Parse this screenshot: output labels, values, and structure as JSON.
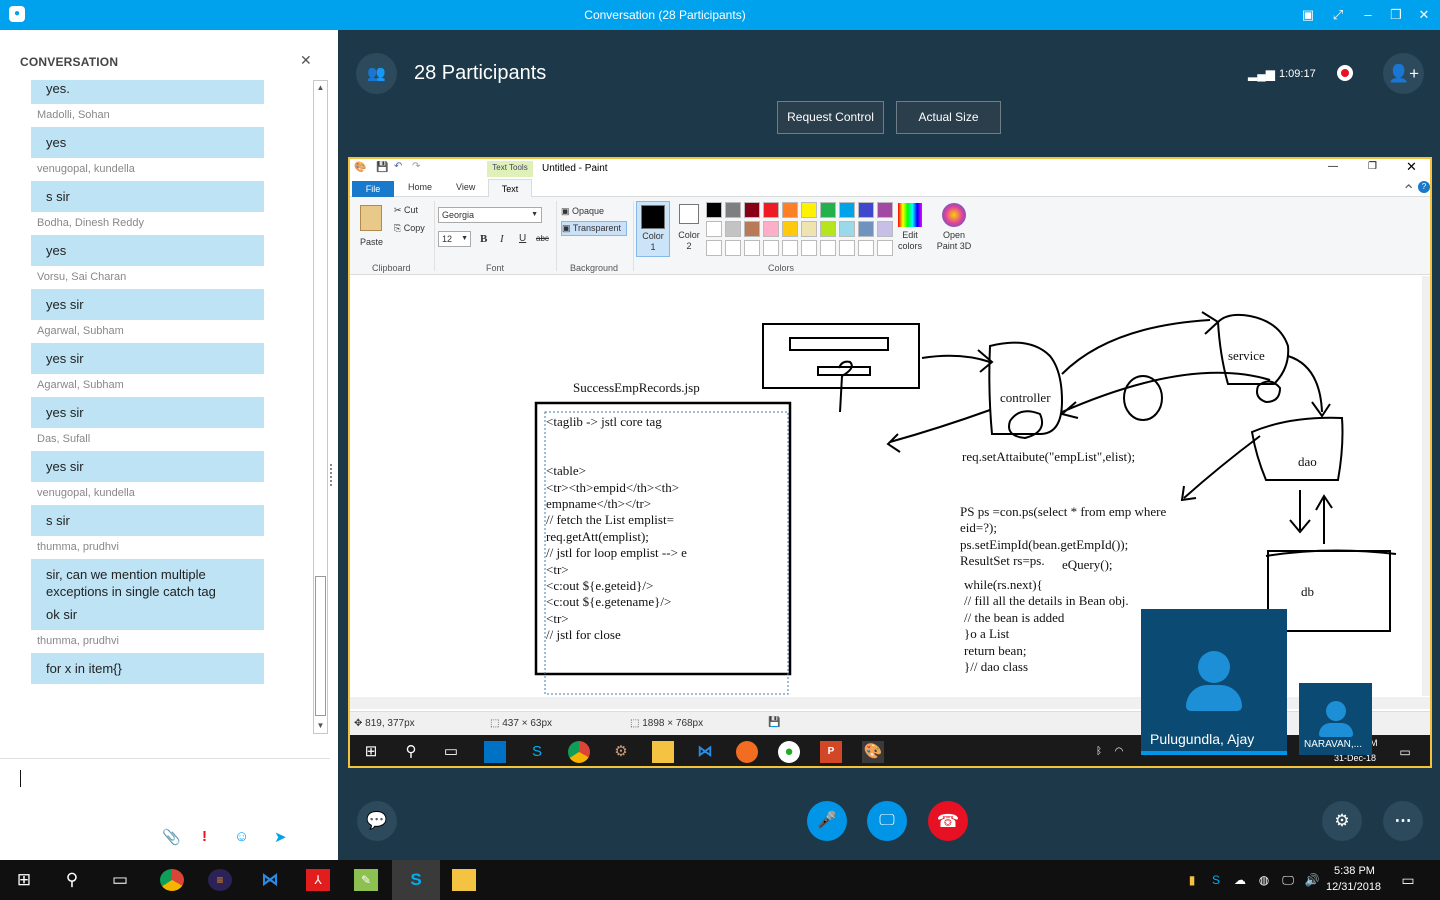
{
  "window": {
    "title": "Conversation (28 Participants)"
  },
  "conversation": {
    "header": "CONVERSATION",
    "messages": [
      {
        "sender": "",
        "text": "yes.",
        "extra": ""
      },
      {
        "sender": "Madolli, Sohan",
        "text": "yes",
        "extra": ""
      },
      {
        "sender": "venugopal, kundella",
        "text": "s sir",
        "extra": ""
      },
      {
        "sender": "Bodha, Dinesh Reddy",
        "text": "yes",
        "extra": ""
      },
      {
        "sender": "Vorsu, Sai Charan",
        "text": "yes sir",
        "extra": ""
      },
      {
        "sender": "Agarwal, Subham",
        "text": "yes sir",
        "extra": ""
      },
      {
        "sender": "Agarwal, Subham",
        "text": "yes sir",
        "extra": ""
      },
      {
        "sender": "Das, Sufall",
        "text": "yes sir",
        "extra": ""
      },
      {
        "sender": "venugopal, kundella",
        "text": "s sir",
        "extra": ""
      },
      {
        "sender": "thumma, prudhvi",
        "text": "sir, can we mention multiple exceptions in single catch tag",
        "extra": "ok sir"
      },
      {
        "sender": "thumma, prudhvi",
        "text": "for x in item{}",
        "extra": ""
      }
    ]
  },
  "call": {
    "participants_label": "28 Participants",
    "duration": "1:09:17",
    "request_control": "Request Control",
    "actual_size": "Actual Size"
  },
  "paint": {
    "title": "Untitled - Paint",
    "context_tab": "Text Tools",
    "tabs": {
      "file": "File",
      "home": "Home",
      "view": "View",
      "text": "Text"
    },
    "clipboard": {
      "paste": "Paste",
      "cut": "Cut",
      "copy": "Copy",
      "group": "Clipboard"
    },
    "font": {
      "family": "Georgia",
      "size": "12",
      "group": "Font",
      "bold": "B",
      "italic": "I",
      "underline": "U",
      "strike": "abc"
    },
    "background": {
      "opaque": "Opaque",
      "transparent": "Transparent",
      "group": "Background"
    },
    "colors": {
      "color1": "Color 1",
      "color2": "Color 2",
      "edit": "Edit colors",
      "group": "Colors",
      "open3d": "Open Paint 3D",
      "palette": [
        "#000000",
        "#7f7f7f",
        "#880015",
        "#ed1c24",
        "#ff7f27",
        "#fff200",
        "#22b14c",
        "#00a2e8",
        "#3f48cc",
        "#a349a4",
        "#ffffff",
        "#c3c3c3",
        "#b97a57",
        "#ffaec9",
        "#ffc90e",
        "#efe4b0",
        "#b5e61d",
        "#99d9ea",
        "#7092be",
        "#c8bfe7"
      ]
    },
    "status": {
      "cursor": "819, 377px",
      "selection": "437 × 63px",
      "size": "1898 × 768px"
    },
    "canvas": {
      "jsp_title": "SuccessEmpRecords.jsp",
      "jsp_lines": [
        "<taglib -> jstl core tag",
        "",
        "",
        "<table>",
        "<tr><th>empid</th><th>",
        "empname</th></tr>",
        "// fetch the List emplist=",
        "req.getAtt(emplist);",
        "// jstl for loop emplist --> e",
        "<tr>",
        "<c:out ${e.geteid}/>",
        "<c:out ${e.getename}/>",
        "<tr>",
        "// jstl for close"
      ],
      "controller": "controller",
      "service": "service",
      "dao": "dao",
      "db": "db",
      "setattr": "req.setAttaibute(\"empList\",elist);",
      "code_lines": [
        "PS ps =con.ps(select * from emp where",
        "eid=?);",
        "ps.setEimpId(bean.getEmpId());",
        "ResultSet rs=ps."
      ],
      "exec": "eQuery();",
      "loop_lines": [
        "while(rs.next){",
        "// fill all the details in Bean obj.",
        "// the bean is added",
        "}o a List",
        "return bean;",
        "}// dao class"
      ]
    }
  },
  "taskbar_inner": {
    "time": "M",
    "date": "31-Dec-18"
  },
  "video": {
    "main_name": "Pulugundla, Ajay",
    "small_name": "NARAVAN,..."
  },
  "clock": {
    "time": "5:38 PM",
    "date": "12/31/2018"
  }
}
